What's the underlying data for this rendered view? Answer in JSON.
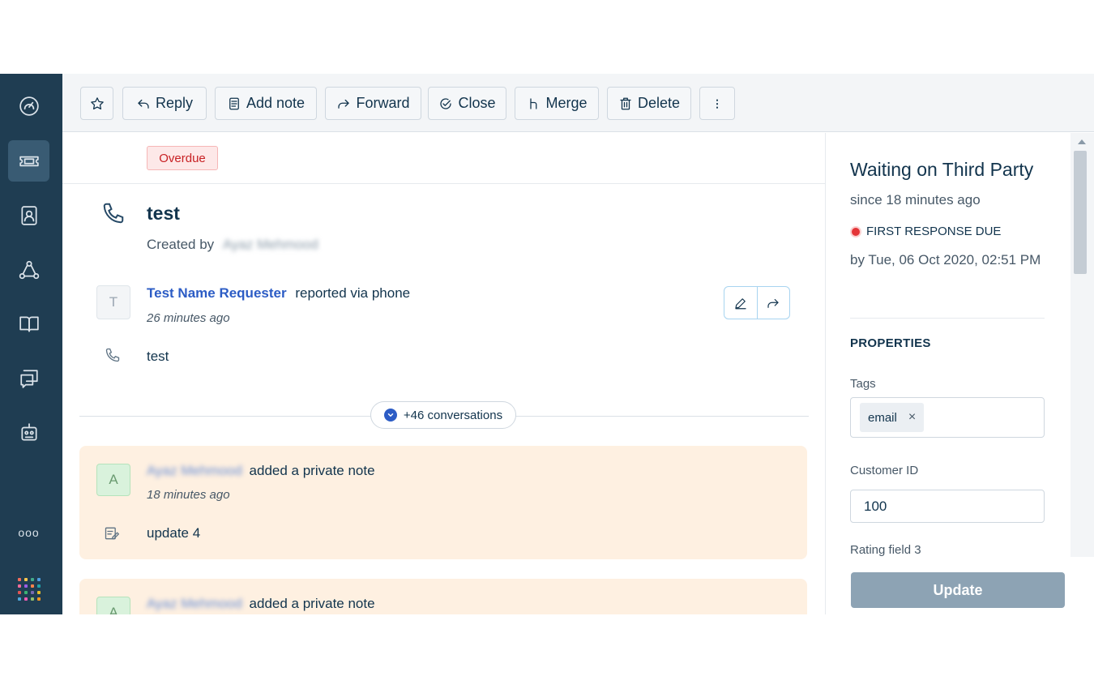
{
  "toolbar": {
    "reply": "Reply",
    "add_note": "Add note",
    "forward": "Forward",
    "close": "Close",
    "merge": "Merge",
    "delete": "Delete"
  },
  "nav": {
    "more": "ooo",
    "app_grid_colors": [
      "#f26d5b",
      "#f9c74f",
      "#43aa8b",
      "#4d9de0",
      "#ee6c9b",
      "#9b5de5",
      "#f9844a",
      "#1fa2a8",
      "#e15554",
      "#3bb273",
      "#7768ae",
      "#e1bc29",
      "#4ea5d9",
      "#f15bb5",
      "#90be6d",
      "#f8961e"
    ]
  },
  "ticket": {
    "badge": "Overdue",
    "title": "test",
    "created_by_label": "Created by",
    "created_by_name": "Ayaz Mehmood",
    "requester_avatar": "T",
    "requester_name": "Test Name Requester",
    "requester_action": "reported via phone",
    "requester_time": "26 minutes ago",
    "description": "test",
    "conversations_label": "+46 conversations"
  },
  "notes": [
    {
      "avatar": "A",
      "author": "Ayaz Mehmood",
      "action": "added a private note",
      "time": "18 minutes ago",
      "body": "update 4"
    },
    {
      "avatar": "A",
      "author": "Ayaz Mehmood",
      "action": "added a private note"
    }
  ],
  "side": {
    "status": "Waiting on Third Party",
    "since": "since 18 minutes ago",
    "due_label": "FIRST RESPONSE DUE",
    "due_date": "by Tue, 06 Oct 2020, 02:51 PM",
    "properties_label": "PROPERTIES",
    "tags_label": "Tags",
    "tag_value": "email",
    "tag_remove": "×",
    "customer_id_label": "Customer ID",
    "customer_id_value": "100",
    "rating_label": "Rating field 3",
    "update_button": "Update"
  },
  "colors": {
    "nav_bg": "#1f3d52",
    "link_blue": "#2c5cc5",
    "overdue_red": "#c82124",
    "note_bg": "#fef0e1",
    "update_btn": "#8da3b4"
  }
}
